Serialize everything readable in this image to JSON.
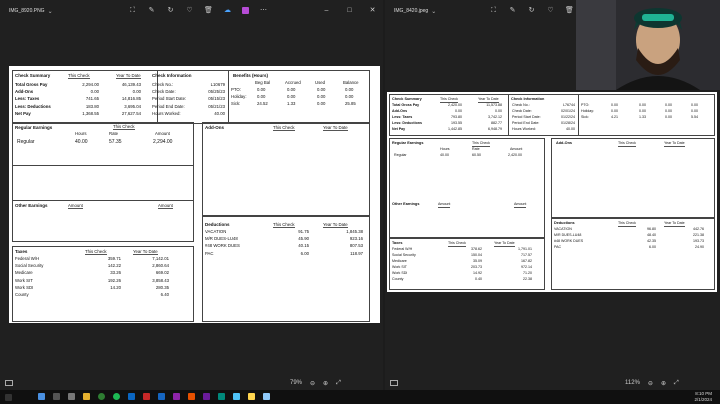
{
  "left_window": {
    "filename": "IMG_8920.PNG",
    "zoom": "79%",
    "stub": {
      "summary": {
        "title": "Check Summary",
        "col1": "This Check",
        "col2": "Year To Date",
        "rows": [
          {
            "label": "Total Gross Pay",
            "this": "2,294.00",
            "ytd": "46,139.43"
          },
          {
            "label": "Add-Ons",
            "this": "0.00",
            "ytd": "0.00"
          },
          {
            "label": "Less: Taxes",
            "this": "741.65",
            "ytd": "14,816.85"
          },
          {
            "label": "Less: Deductions",
            "this": "183.80",
            "ytd": "3,695.04"
          },
          {
            "label": "Net Pay",
            "this": "1,368.55",
            "ytd": "27,627.54"
          }
        ]
      },
      "info": {
        "title": "Check Information",
        "rows": [
          {
            "label": "Check No.:",
            "value": "L10679"
          },
          {
            "label": "Check Date:",
            "value": "05/25/23"
          },
          {
            "label": "Period Start Date:",
            "value": "05/15/23"
          },
          {
            "label": "Period End Date:",
            "value": "05/21/23"
          },
          {
            "label": "Hours Worked:",
            "value": "40.00"
          }
        ]
      },
      "benefits": {
        "title": "Benefits (Hours)",
        "cols": [
          "Beg Bal",
          "Accrued",
          "Used",
          "Balance"
        ],
        "rows": [
          {
            "label": "PTO:",
            "v": [
              "0.00",
              "0.00",
              "0.00",
              "0.00"
            ]
          },
          {
            "label": "Holiday:",
            "v": [
              "0.00",
              "0.00",
              "0.00",
              "0.00"
            ]
          },
          {
            "label": "Sick:",
            "v": [
              "24.52",
              "1.33",
              "0.00",
              "25.85"
            ]
          }
        ]
      },
      "regular": {
        "title": "Regular Earnings",
        "this_check": "This Check",
        "cols": [
          "Hours",
          "Rate",
          "Amount"
        ],
        "row": {
          "label": "Regular",
          "hours": "40.00",
          "rate": "57.35",
          "amount": "2,294.00"
        }
      },
      "addons": {
        "title": "Add-Ons",
        "col1": "This Check",
        "col2": "Year To Date"
      },
      "other": {
        "title": "Other Earnings",
        "col1": "Amount",
        "col2": "Amount"
      },
      "deductions": {
        "title": "Deductions",
        "col1": "This Check",
        "col2": "Year To Date",
        "rows": [
          {
            "label": "VACATION",
            "this": "91.75",
            "ytd": "1,845.38"
          },
          {
            "label": "M/R DUES-LU48",
            "this": "45.90",
            "ytd": "923.16"
          },
          {
            "label": "#48 WORK DUES",
            "this": "40.15",
            "ytd": "807.53"
          },
          {
            "label": "PAC",
            "this": "6.00",
            "ytd": "118.97"
          }
        ]
      },
      "taxes": {
        "title": "Taxes",
        "col1": "This Check",
        "col2": "Year To Date",
        "rows": [
          {
            "label": "Federal W/H",
            "this": "359.71",
            "ytd": "7,142.01"
          },
          {
            "label": "Social Security",
            "this": "142.22",
            "ytd": "2,860.64"
          },
          {
            "label": "Medicare",
            "this": "33.26",
            "ytd": "669.02"
          },
          {
            "label": "Work SIT",
            "this": "192.26",
            "ytd": "3,858.43"
          },
          {
            "label": "Work SDI",
            "this": "14.20",
            "ytd": "280.35"
          },
          {
            "label": "County",
            "this": "",
            "ytd": "6.40"
          }
        ]
      }
    }
  },
  "right_window": {
    "filename": "IMG_8420.jpeg",
    "zoom": "112%",
    "stub": {
      "summary": {
        "title": "Check Summary",
        "col1": "This Check",
        "col2": "Year To Date",
        "rows": [
          {
            "label": "Total Gross Pay",
            "this": "2,420.00",
            "ytd": "11,573.88"
          },
          {
            "label": "Add-Ons",
            "this": "0.00",
            "ytd": "0.00"
          },
          {
            "label": "Less: Taxes",
            "this": "793.80",
            "ytd": "3,742.12"
          },
          {
            "label": "Less: Deductions",
            "this": "193.55",
            "ytd": "882.77"
          },
          {
            "label": "Net Pay",
            "this": "1,442.85",
            "ytd": "6,948.79"
          }
        ]
      },
      "info": {
        "title": "Check Information",
        "rows": [
          {
            "label": "Check No.:",
            "value": "L76744"
          },
          {
            "label": "Check Date:",
            "value": "02/01/24"
          },
          {
            "label": "Period Start Date:",
            "value": "01/22/24"
          },
          {
            "label": "Period End Date:",
            "value": "01/28/24"
          },
          {
            "label": "Hours Worked:",
            "value": "40.00"
          }
        ]
      },
      "benefits": {
        "rows": [
          {
            "label": "PTO:",
            "v": [
              "0.00",
              "0.00",
              "0.00",
              "0.00"
            ]
          },
          {
            "label": "Holiday:",
            "v": [
              "0.00",
              "0.00",
              "0.00",
              "0.00"
            ]
          },
          {
            "label": "Sick:",
            "v": [
              "4.21",
              "1.33",
              "0.00",
              "5.54"
            ]
          }
        ]
      },
      "regular": {
        "title": "Regular Earnings",
        "this_check": "This Check",
        "cols": [
          "Hours",
          "Rate",
          "Amount"
        ],
        "row": {
          "label": "Regular",
          "hours": "40.00",
          "rate": "60.50",
          "amount": "2,420.00"
        }
      },
      "addons": {
        "title": "Add-Ons",
        "col1": "This Check",
        "col2": "Year To Date"
      },
      "other": {
        "title": "Other Earnings",
        "col1": "Amount",
        "col2": "Amount"
      },
      "deductions": {
        "title": "Deductions",
        "col1": "This Check",
        "col2": "Year To Date",
        "rows": [
          {
            "label": "VACATION",
            "this": "96.80",
            "ytd": "442.76"
          },
          {
            "label": "M/R DUES-LU48",
            "this": "48.40",
            "ytd": "221.38"
          },
          {
            "label": "#48 WORK DUES",
            "this": "42.35",
            "ytd": "193.73"
          },
          {
            "label": "PAC",
            "this": "6.00",
            "ytd": "24.90"
          }
        ]
      },
      "taxes": {
        "title": "Taxes",
        "col1": "This Check",
        "col2": "Year To Date",
        "rows": [
          {
            "label": "Federal W/H",
            "this": "378.62",
            "ytd": "1,791.01"
          },
          {
            "label": "Social Security",
            "this": "150.04",
            "ytd": "717.57"
          },
          {
            "label": "Medicare",
            "this": "35.09",
            "ytd": "167.82"
          },
          {
            "label": "Work SIT",
            "this": "203.73",
            "ytd": "972.14"
          },
          {
            "label": "Work SDI",
            "this": "14.92",
            "ytd": "71.20"
          },
          {
            "label": "County",
            "this": "0.40",
            "ytd": "22.38"
          }
        ]
      }
    }
  },
  "taskbar": {
    "time": "8:10 PM",
    "date": "2/1/2024"
  },
  "colors": {
    "window_bg": "#202020",
    "accent_purple": "#a77cff",
    "accent_blue": "#4aa3ff"
  }
}
